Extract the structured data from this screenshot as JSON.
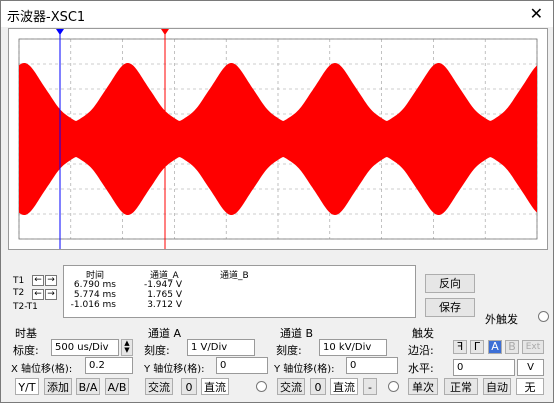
{
  "window": {
    "title": "示波器-XSC1"
  },
  "readout": {
    "rows": [
      {
        "label": "T1"
      },
      {
        "label": "T2"
      },
      {
        "label": "T2-T1"
      }
    ],
    "headers": {
      "time": "时间",
      "ch_a": "通道_A",
      "ch_b": "通道_B"
    },
    "time": [
      "6.790 ms",
      "5.774 ms",
      "-1.016 ms"
    ],
    "ch_a": [
      "-1.947 V",
      "1.765 V",
      "3.712 V"
    ]
  },
  "buttons": {
    "reverse": "反向",
    "save": "保存",
    "ext_trigger": "外触发"
  },
  "timebase": {
    "title": "时基",
    "scale_label": "标度:",
    "scale_value": "500 us/Div",
    "xpos_label": "X 轴位移(格):",
    "xpos_value": "0.2",
    "modes": [
      "Y/T",
      "添加",
      "B/A",
      "A/B"
    ]
  },
  "channel_a": {
    "title": "通道 A",
    "scale_label": "刻度:",
    "scale_value": "1  V/Div",
    "ypos_label": "Y 轴位移(格):",
    "ypos_value": "0",
    "coupling": [
      "交流",
      "0",
      "直流"
    ]
  },
  "channel_b": {
    "title": "通道 B",
    "scale_label": "刻度:",
    "scale_value": "10 kV/Div",
    "ypos_label": "Y 轴位移(格):",
    "ypos_value": "0",
    "coupling": [
      "交流",
      "0",
      "直流",
      "-"
    ]
  },
  "trigger": {
    "title": "触发",
    "edge_label": "边沿:",
    "edge_buttons": [
      "ꟻ",
      "ᒥ",
      "A",
      "B",
      "Ext"
    ],
    "level_label": "水平:",
    "level_value": "0",
    "level_unit": "V",
    "modes": [
      "单次",
      "正常",
      "自动",
      "无"
    ]
  },
  "colors": {
    "trace_a": "#ff0000",
    "cursor1": "#0000ff",
    "cursor2": "#ff0000",
    "grid": "#999999"
  }
}
